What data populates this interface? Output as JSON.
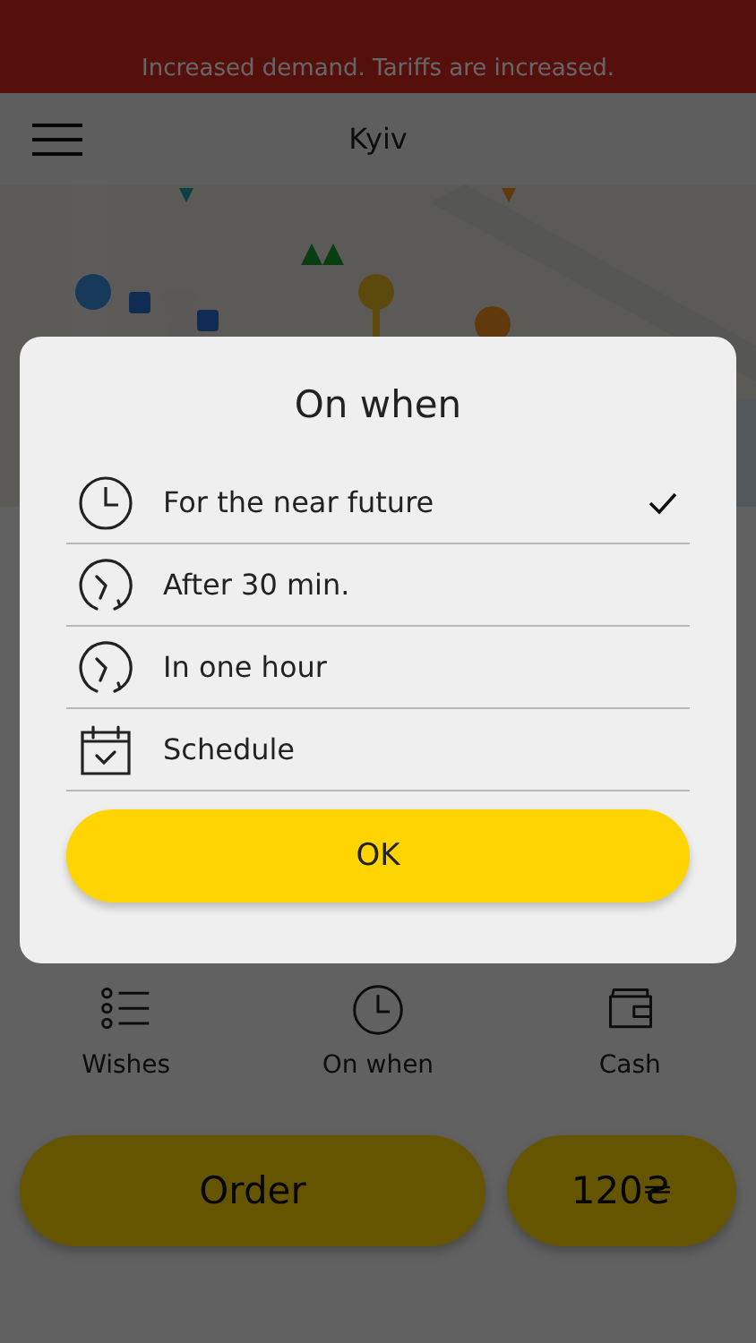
{
  "status_banner": {
    "text": "Increased demand. Tariffs are increased."
  },
  "header": {
    "title": "Kyiv"
  },
  "dialog": {
    "title": "On when",
    "options": [
      {
        "label": "For the near future",
        "selected": true
      },
      {
        "label": "After 30 min.",
        "selected": false
      },
      {
        "label": "In one hour",
        "selected": false
      },
      {
        "label": "Schedule",
        "selected": false
      }
    ],
    "ok_button": "OK"
  },
  "options_bar": [
    {
      "label": "Wishes"
    },
    {
      "label": "On when"
    },
    {
      "label": "Cash"
    }
  ],
  "order_button": "Order",
  "price_button": "120₴"
}
